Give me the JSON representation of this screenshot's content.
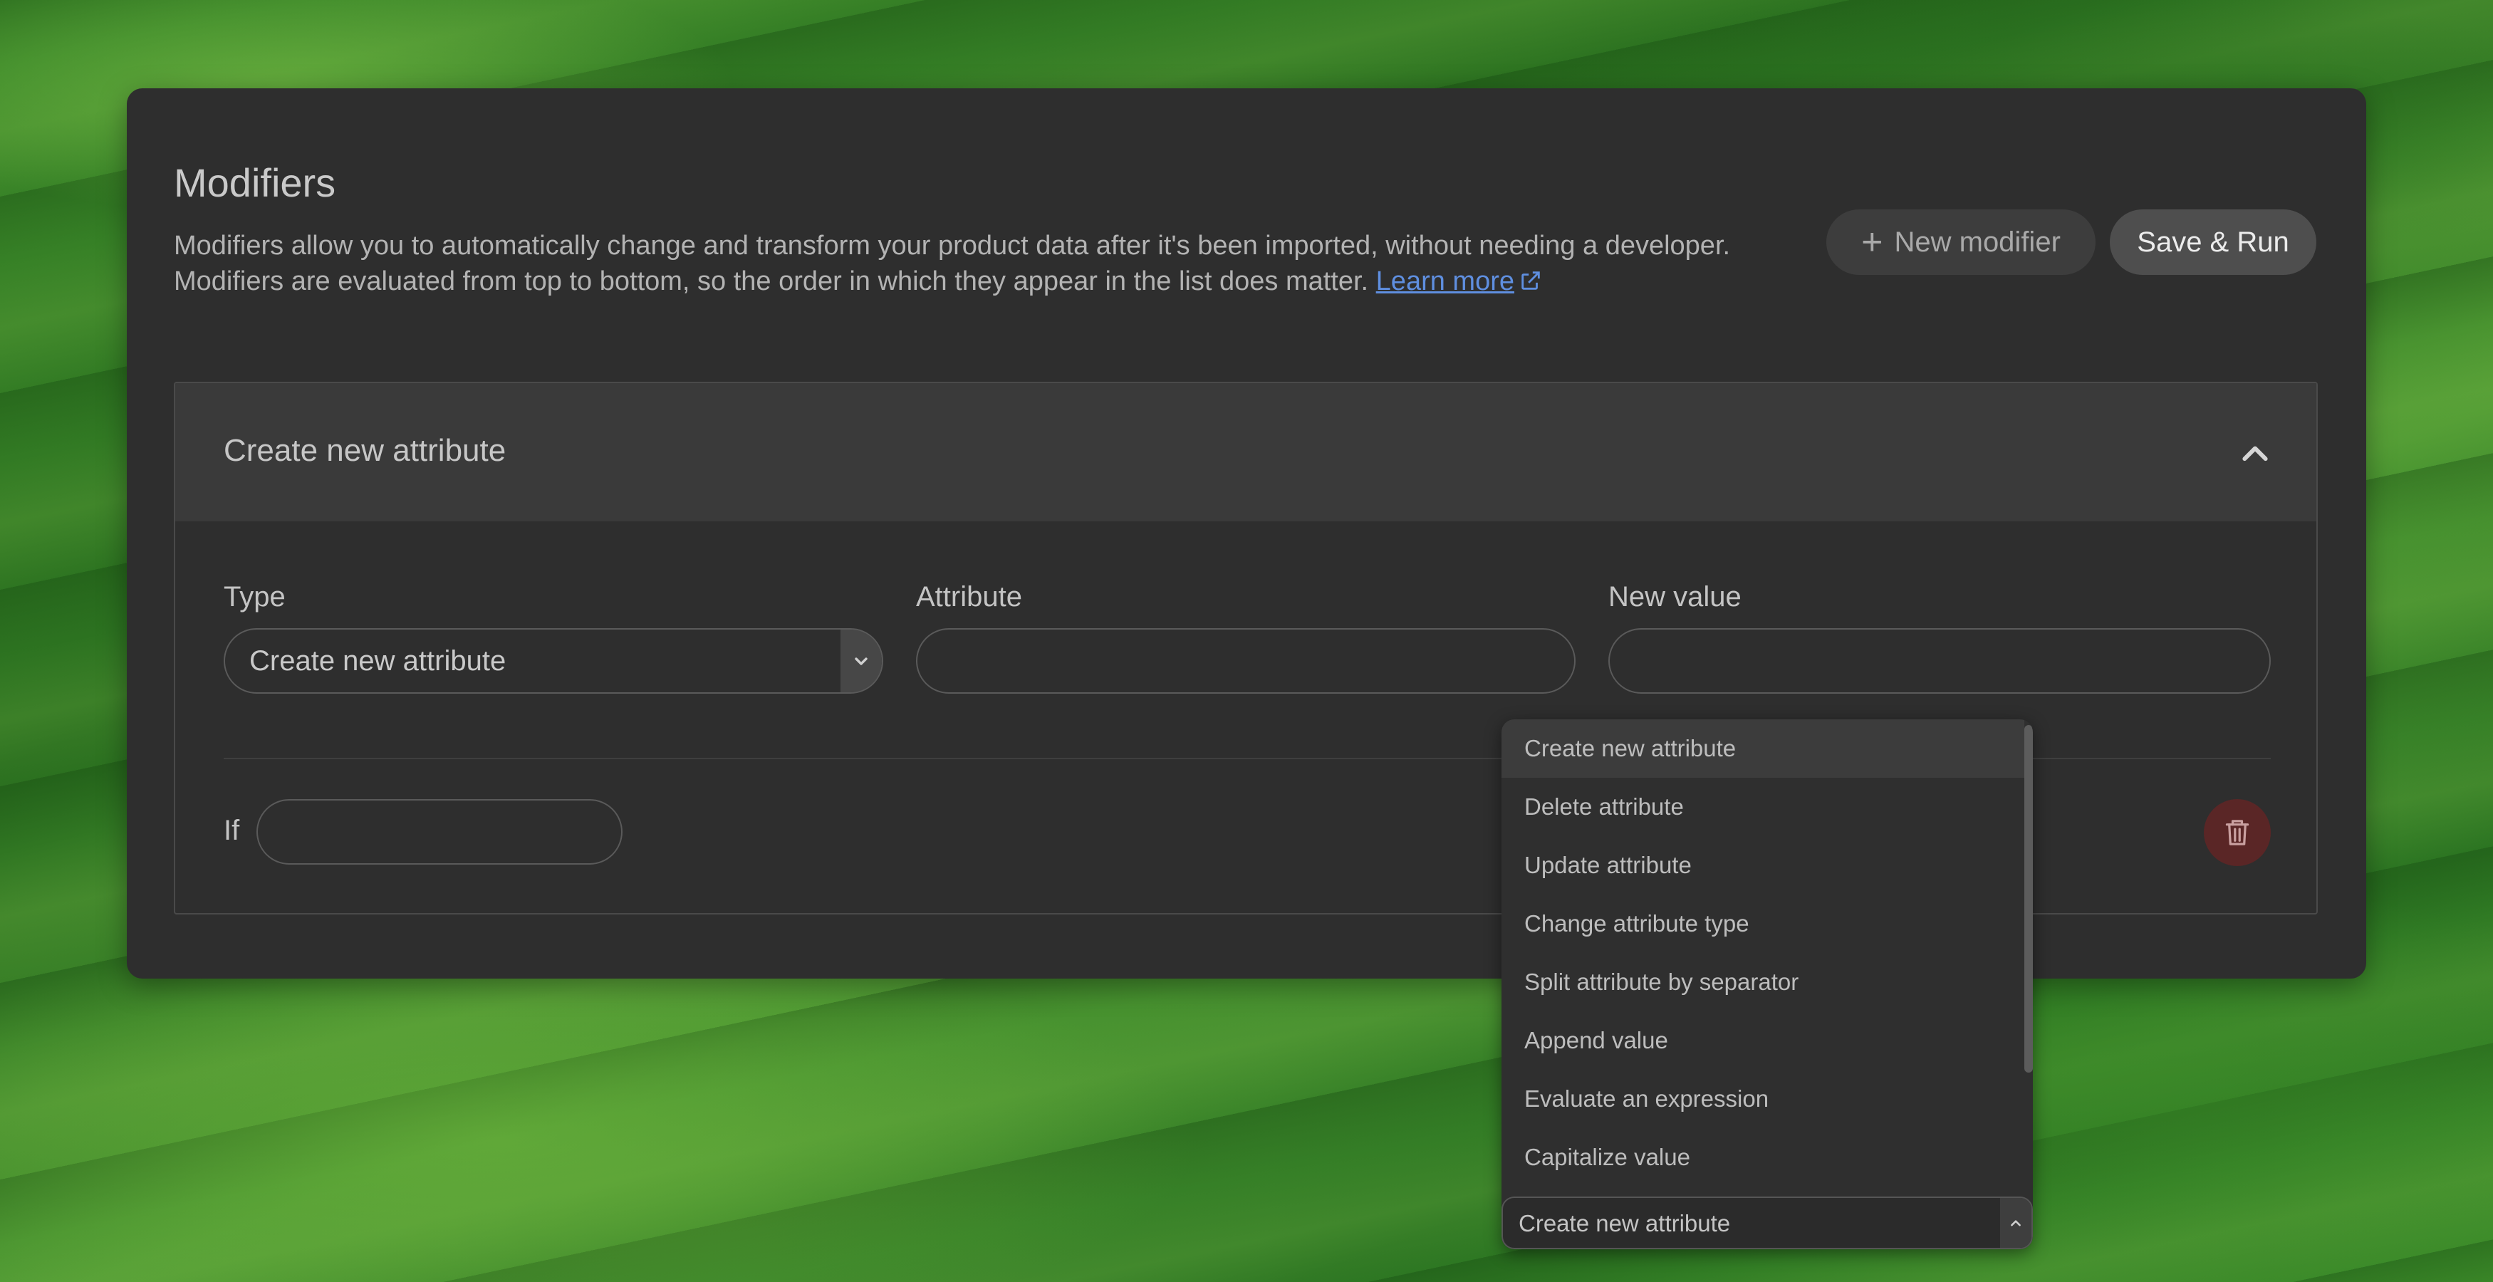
{
  "header": {
    "title": "Modifiers",
    "description_line1": "Modifiers allow you to automatically change and transform your product data after it's been imported, without needing a developer.",
    "description_line2": "Modifiers are evaluated from top to bottom, so the order in which they appear in the list does matter.",
    "learn_more_label": "Learn more"
  },
  "actions": {
    "new_modifier_label": "New modifier",
    "save_run_label": "Save & Run"
  },
  "modifier_card": {
    "title": "Create new attribute",
    "type_label": "Type",
    "type_value": "Create new attribute",
    "attribute_label": "Attribute",
    "attribute_value": "",
    "new_value_label": "New value",
    "new_value_value": "",
    "if_label": "If",
    "if_value": ""
  },
  "type_dropdown": {
    "options": [
      "Create new attribute",
      "Delete attribute",
      "Update attribute",
      "Change attribute type",
      "Split attribute by separator",
      "Append value",
      "Evaluate an expression",
      "Capitalize value"
    ],
    "selected": "Create new attribute"
  },
  "colors": {
    "panel_bg": "#2e2e2e",
    "link": "#5f8fe0",
    "delete_button": "#5a2626"
  },
  "icons": {
    "new_modifier": "plus-icon",
    "learn_more": "external-link-icon",
    "collapse": "chevron-up-icon",
    "select_caret": "chevron-down-icon",
    "delete": "trash-icon"
  }
}
